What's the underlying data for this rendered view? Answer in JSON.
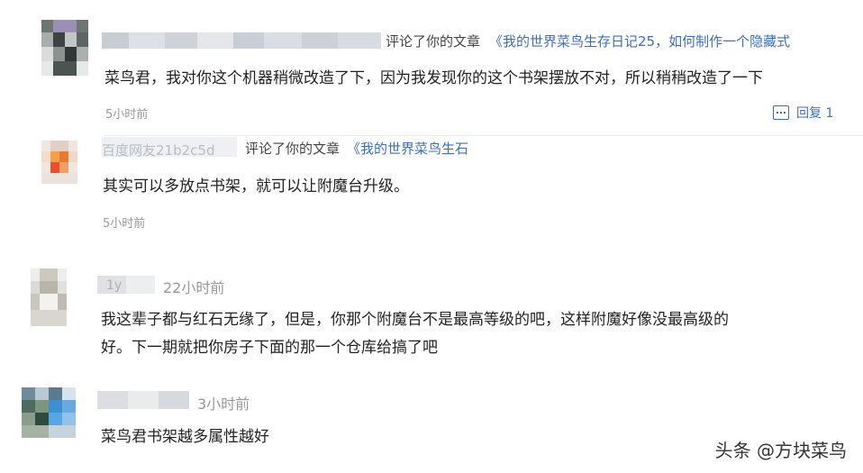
{
  "comments": [
    {
      "action": "评论了你的文章",
      "article": "《我的世界菜鸟生存日记25，如何制作一个隐藏式",
      "text": "菜鸟君，我对你这个机器稍微改造了下，因为我发现你的这个书架摆放不对，所以稍稍改造了一下",
      "time": "5小时前",
      "reply_label": "回复 1"
    },
    {
      "username_partial": "百度网友21b2c5d",
      "action": "评论了你的文章",
      "article": "《我的世界菜鸟生石",
      "text": "其实可以多放点书架，就可以让附魔台升级。",
      "time": "5小时前"
    },
    {
      "username_partial": "1y",
      "time": "22小时前",
      "text_lines": [
        "我这辈子都与红石无缘了，但是，你那个附魔台不是最高等级的吧，这样附魔好像没最高级的",
        "好。下一期就把你房子下面的那一个仓库给搞了吧"
      ]
    },
    {
      "time": "3小时前",
      "text": "菜鸟君书架越多属性越好"
    }
  ],
  "watermark": "头条 @方块菜鸟",
  "colors": {
    "link": "#3f6fb3",
    "meta": "#999999",
    "text": "#222222"
  }
}
